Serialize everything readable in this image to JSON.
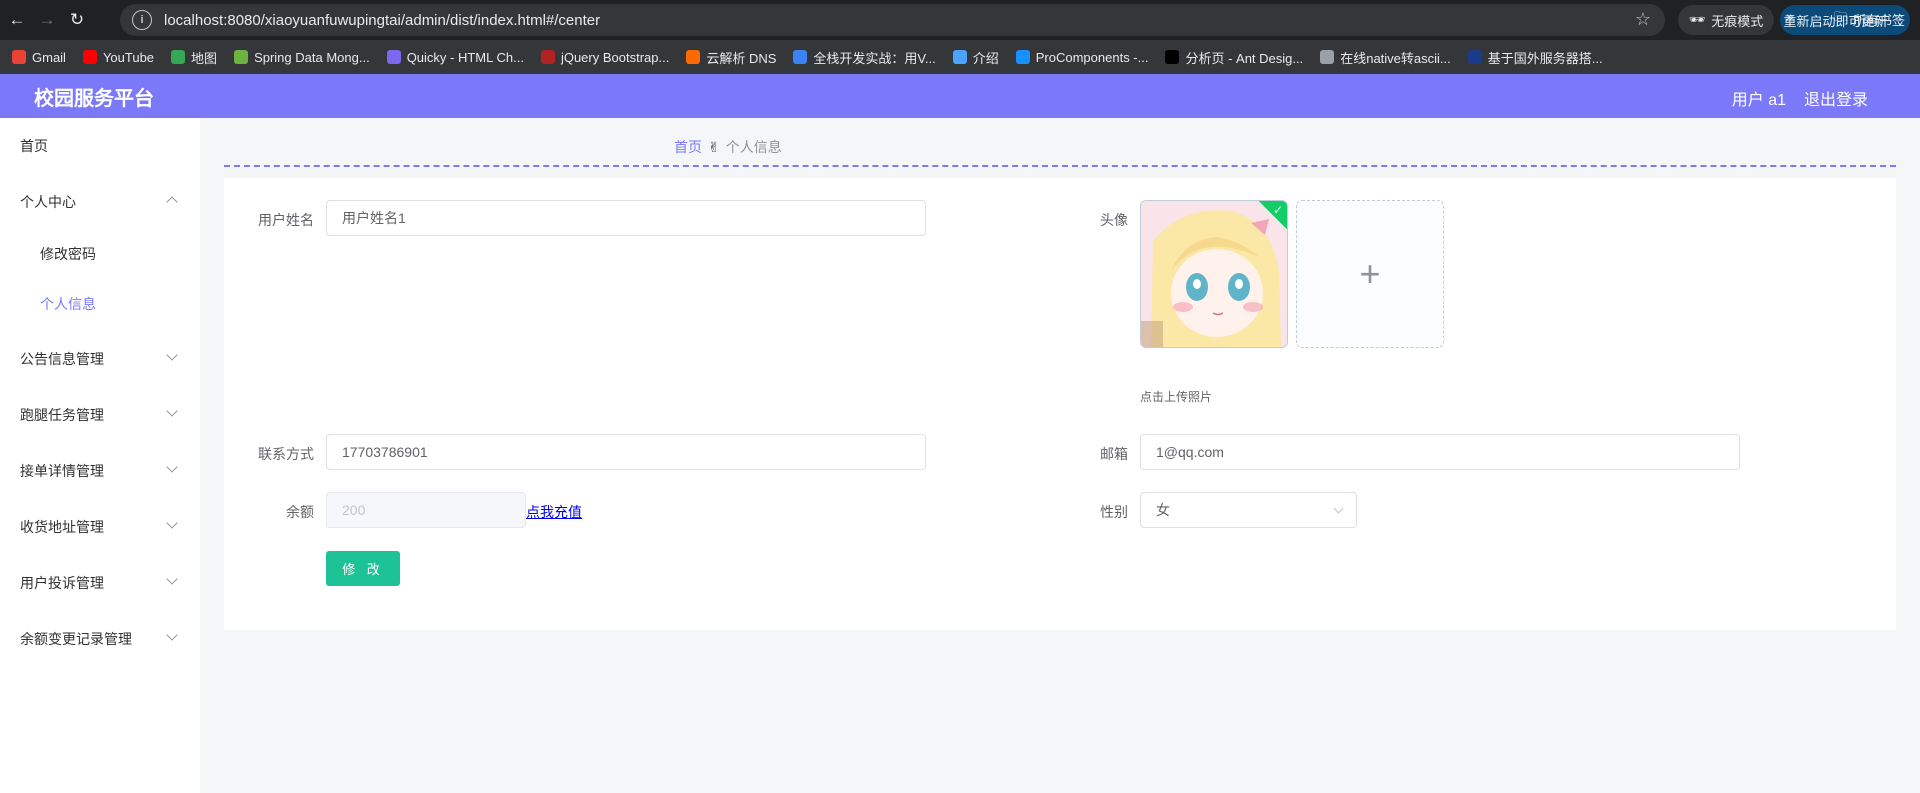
{
  "browser": {
    "url": "localhost:8080/xiaoyuanfuwupingtai/admin/dist/index.html#/center",
    "incognito_label": "无痕模式",
    "restart_label": "重新启动即可更新",
    "bookmarks": [
      {
        "label": "Gmail",
        "icon": "gmail-icon",
        "color": "#ea4335"
      },
      {
        "label": "YouTube",
        "icon": "youtube-icon",
        "color": "#ff0000"
      },
      {
        "label": "地图",
        "icon": "maps-icon",
        "color": "#34a853"
      },
      {
        "label": "Spring Data Mong...",
        "icon": "spring-icon",
        "color": "#6db33f"
      },
      {
        "label": "Quicky - HTML Ch...",
        "icon": "quicky-icon",
        "color": "#7b68ee"
      },
      {
        "label": "jQuery Bootstrap...",
        "icon": "jquery-icon",
        "color": "#b22222"
      },
      {
        "label": "云解析 DNS",
        "icon": "aliyun-icon",
        "color": "#ff6a00"
      },
      {
        "label": "全栈开发实战：用V...",
        "icon": "m-icon",
        "color": "#3b82f6"
      },
      {
        "label": "介绍",
        "icon": "globe-icon",
        "color": "#4aa3ff"
      },
      {
        "label": "ProComponents -...",
        "icon": "procomponents-icon",
        "color": "#1890ff"
      },
      {
        "label": "分析页 - Ant Desig...",
        "icon": "pro-icon",
        "color": "#000000"
      },
      {
        "label": "在线native转ascii...",
        "icon": "world-icon",
        "color": "#9aa0a6"
      },
      {
        "label": "基于国外服务器搭...",
        "icon": "flag-icon",
        "color": "#1a3a8a"
      }
    ],
    "more_label": "»",
    "all_bookmarks_label": "所有书签"
  },
  "header": {
    "title": "校园服务平台",
    "user_label": "用户 a1",
    "logout_label": "退出登录"
  },
  "sidebar": {
    "items": [
      {
        "label": "首页"
      },
      {
        "label": "个人中心"
      },
      {
        "label": "修改密码"
      },
      {
        "label": "个人信息"
      },
      {
        "label": "公告信息管理"
      },
      {
        "label": "跑腿任务管理"
      },
      {
        "label": "接单详情管理"
      },
      {
        "label": "收货地址管理"
      },
      {
        "label": "用户投诉管理"
      },
      {
        "label": "余额变更记录管理"
      }
    ]
  },
  "breadcrumb": {
    "home": "首页",
    "separator": "✌",
    "current": "个人信息"
  },
  "form": {
    "username_label": "用户姓名",
    "username_value": "用户姓名1",
    "avatar_label": "头像",
    "upload_tip": "点击上传照片",
    "upload_plus": "+",
    "phone_label": "联系方式",
    "phone_value": "17703786901",
    "email_label": "邮箱",
    "email_value": "1@qq.com",
    "balance_label": "余额",
    "balance_value": "200",
    "recharge_link": "点我充值",
    "gender_label": "性别",
    "gender_value": "女",
    "submit_label": "修 改"
  },
  "colors": {
    "accent": "#7b79fa",
    "button": "#1dc396",
    "success_badge": "#13ce66"
  }
}
